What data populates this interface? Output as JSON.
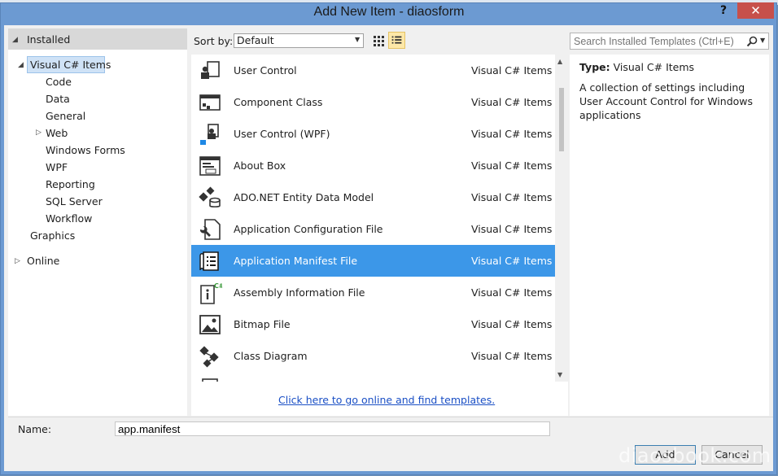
{
  "window": {
    "title": "Add New Item - diaosform",
    "help_label": "?",
    "close_label": "✕"
  },
  "left_panel": {
    "installed_label": "Installed",
    "tree": [
      {
        "label": "Visual C# Items",
        "selected": true
      },
      {
        "label": "Code"
      },
      {
        "label": "Data"
      },
      {
        "label": "General"
      },
      {
        "label": "Web"
      },
      {
        "label": "Windows Forms"
      },
      {
        "label": "WPF"
      },
      {
        "label": "Reporting"
      },
      {
        "label": "SQL Server"
      },
      {
        "label": "Workflow"
      },
      {
        "label": "Graphics"
      }
    ],
    "online_label": "Online"
  },
  "toolbar": {
    "sort_by_label": "Sort by:",
    "sort_value": "Default",
    "search_placeholder": "Search Installed Templates (Ctrl+E)"
  },
  "templates": [
    {
      "name": "User Control",
      "category": "Visual C# Items",
      "icon": "user-control-icon"
    },
    {
      "name": "Component Class",
      "category": "Visual C# Items",
      "icon": "component-class-icon"
    },
    {
      "name": "User Control (WPF)",
      "category": "Visual C# Items",
      "icon": "user-control-wpf-icon"
    },
    {
      "name": "About Box",
      "category": "Visual C# Items",
      "icon": "about-box-icon"
    },
    {
      "name": "ADO.NET Entity Data Model",
      "category": "Visual C# Items",
      "icon": "entity-data-model-icon"
    },
    {
      "name": "Application Configuration File",
      "category": "Visual C# Items",
      "icon": "config-file-icon"
    },
    {
      "name": "Application Manifest File",
      "category": "Visual C# Items",
      "icon": "manifest-file-icon",
      "selected": true
    },
    {
      "name": "Assembly Information File",
      "category": "Visual C# Items",
      "icon": "assembly-info-icon"
    },
    {
      "name": "Bitmap File",
      "category": "Visual C# Items",
      "icon": "bitmap-file-icon"
    },
    {
      "name": "Class Diagram",
      "category": "Visual C# Items",
      "icon": "class-diagram-icon"
    }
  ],
  "online_link": "Click here to go online and find templates.",
  "details": {
    "type_label": "Type:",
    "type_value": "Visual C# Items",
    "description": "A collection of settings including User Account Control for Windows applications"
  },
  "name_field": {
    "label": "Name:",
    "value": "app.manifest"
  },
  "buttons": {
    "add": "Add",
    "cancel": "Cancel"
  },
  "watermark": "diaosbook.com",
  "colors": {
    "selection": "#3c97e8",
    "title_bar": "#6c9ad2",
    "close": "#c7504b"
  }
}
